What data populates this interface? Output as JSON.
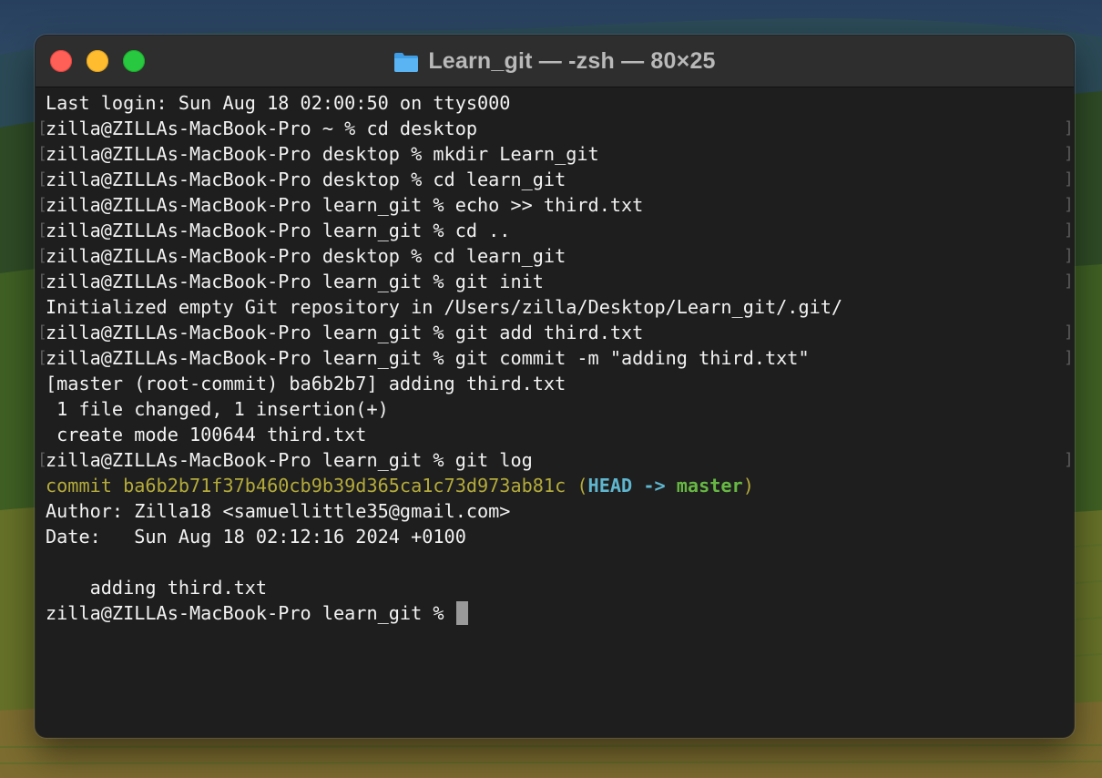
{
  "window": {
    "title": "Learn_git — -zsh — 80×25"
  },
  "terminal": {
    "lines": [
      "Last login: Sun Aug 18 02:00:50 on ttys000",
      "zilla@ZILLAs-MacBook-Pro ~ % cd desktop",
      "zilla@ZILLAs-MacBook-Pro desktop % mkdir Learn_git",
      "zilla@ZILLAs-MacBook-Pro desktop % cd learn_git",
      "zilla@ZILLAs-MacBook-Pro learn_git % echo >> third.txt",
      "zilla@ZILLAs-MacBook-Pro learn_git % cd ..",
      "zilla@ZILLAs-MacBook-Pro desktop % cd learn_git",
      "zilla@ZILLAs-MacBook-Pro learn_git % git init",
      "Initialized empty Git repository in /Users/zilla/Desktop/Learn_git/.git/",
      "zilla@ZILLAs-MacBook-Pro learn_git % git add third.txt",
      "zilla@ZILLAs-MacBook-Pro learn_git % git commit -m \"adding third.txt\"",
      "[master (root-commit) ba6b2b7] adding third.txt",
      " 1 file changed, 1 insertion(+)",
      " create mode 100644 third.txt",
      "zilla@ZILLAs-MacBook-Pro learn_git % git log"
    ],
    "commit_line": {
      "prefix": "commit ba6b2b71f37b460cb9b39d365ca1c73d973ab81c (",
      "head": "HEAD -> ",
      "branch": "master",
      "suffix": ")"
    },
    "author_line": "Author: Zilla18 <samuellittle35@gmail.com>",
    "date_line": "Date:   Sun Aug 18 02:12:16 2024 +0100",
    "blank_line": "",
    "message_line": "    adding third.txt",
    "prompt_line": "zilla@ZILLAs-MacBook-Pro learn_git % ",
    "bracket_left": "[",
    "bracket_right": "]"
  },
  "colors": {
    "commit_hash": "#b4ab3a",
    "head_ref": "#5fb6cf",
    "branch_ref": "#67b843",
    "close_button": "#fe5f57",
    "minimize_button": "#febc2e",
    "zoom_button": "#28c840"
  },
  "icons": {
    "title_icon": "folder-icon"
  }
}
